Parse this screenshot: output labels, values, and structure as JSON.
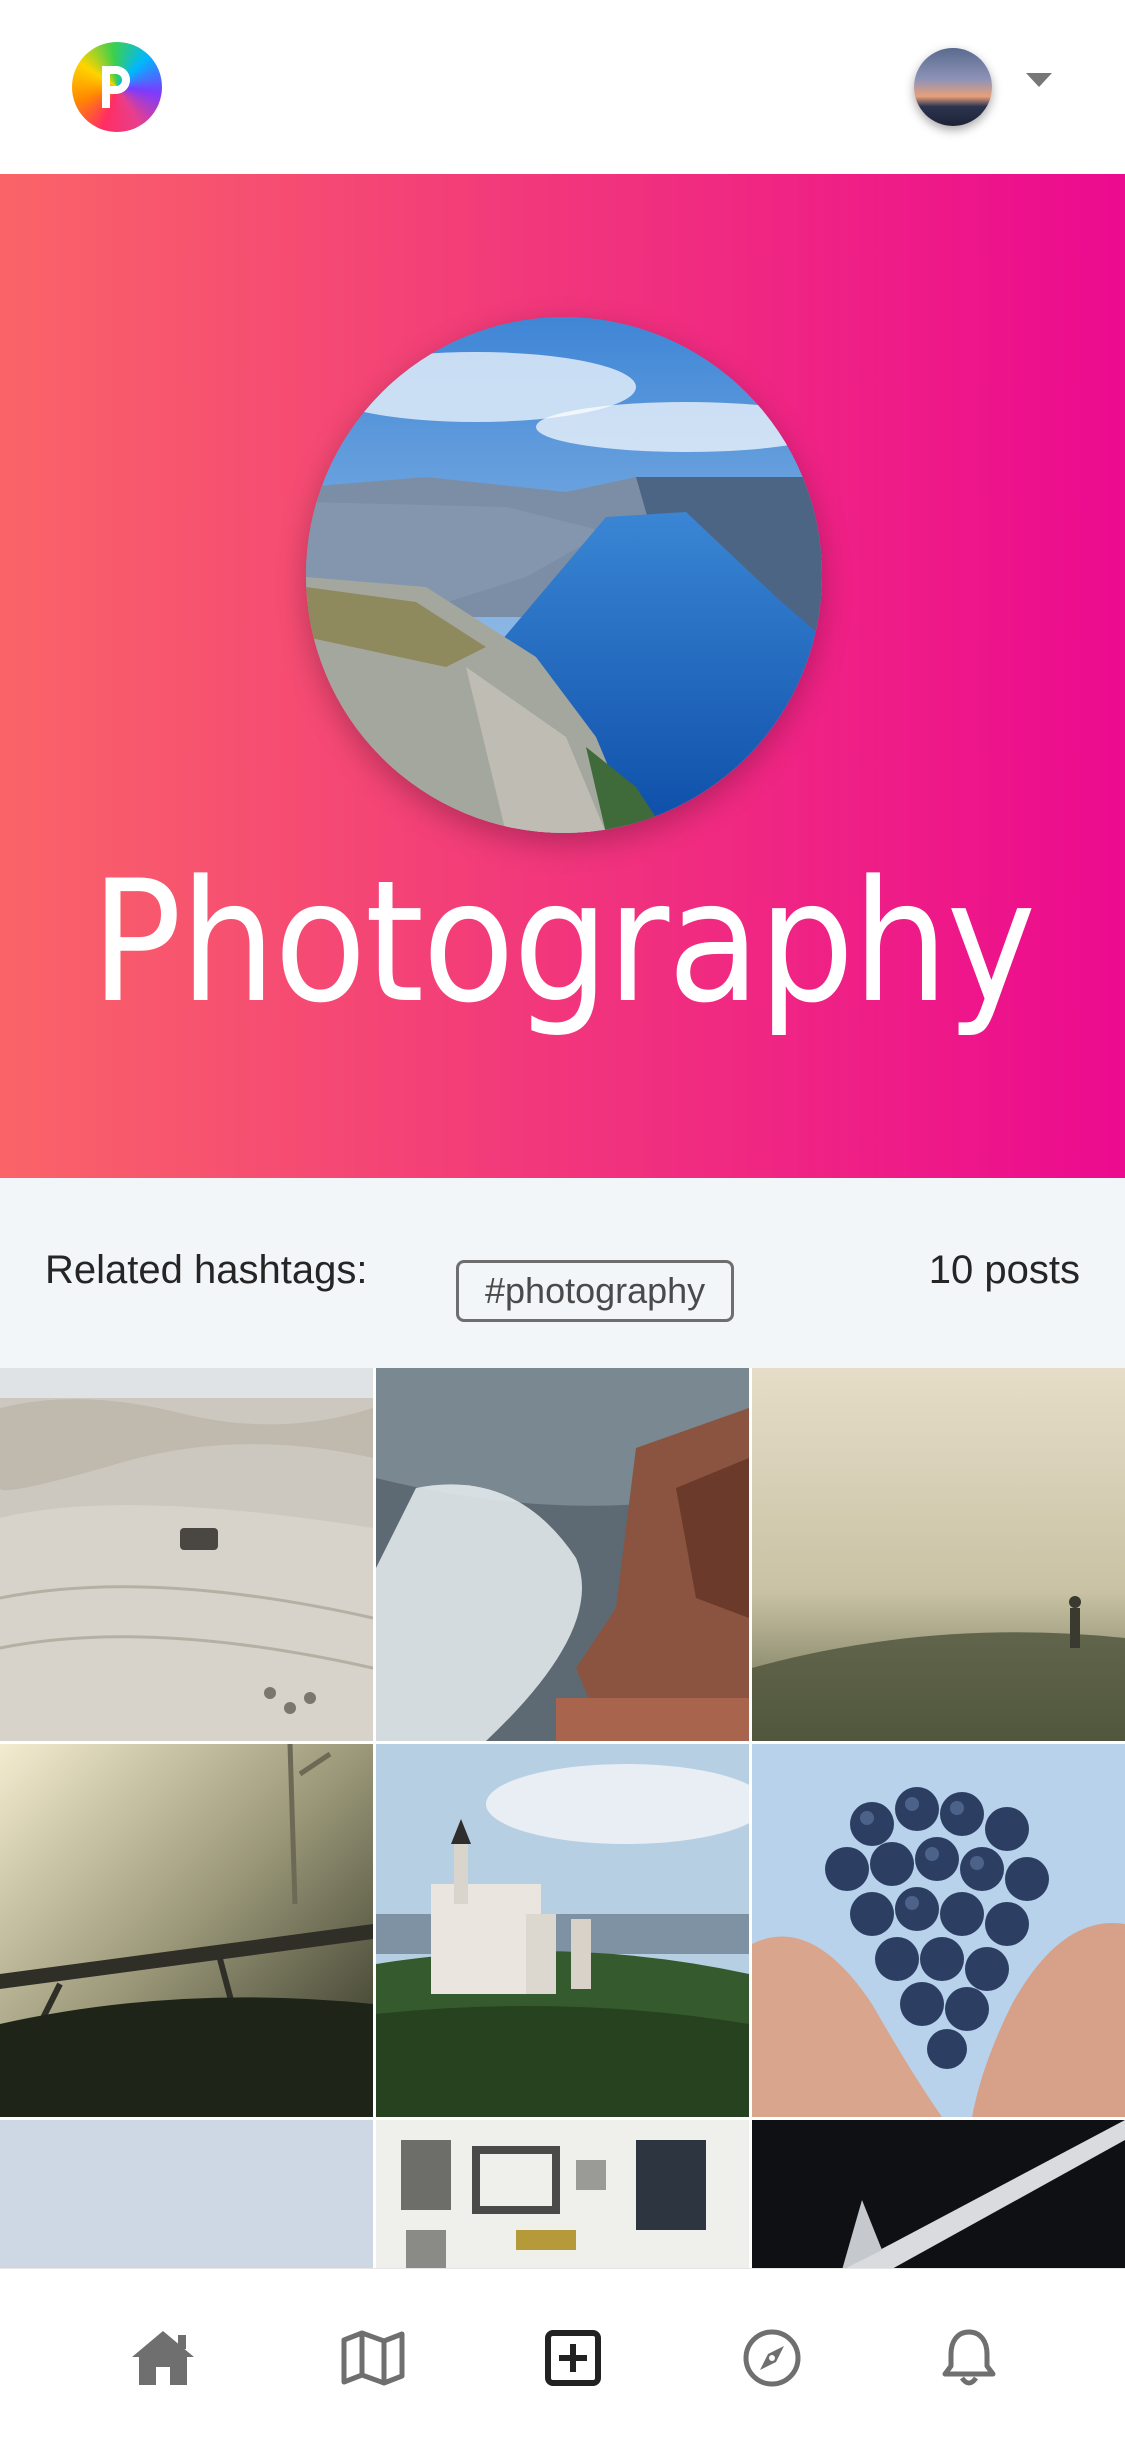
{
  "app": {
    "logo_icon": "app-logo-icon",
    "avatar_icon": "user-avatar",
    "menu_icon": "caret-down-icon"
  },
  "hero": {
    "title": "Photography",
    "cover_image": "fjord-cliff-photo",
    "gradient": [
      "#fa6468",
      "#ec0a8f"
    ]
  },
  "hashtags": {
    "label": "Related hashtags:",
    "tags": [
      "#photography"
    ],
    "post_count": "10 posts"
  },
  "grid": {
    "items": [
      "desert-dunes-jeep-photo",
      "ocean-wave-rocks-photo",
      "foggy-field-person-photo",
      "misty-forest-bridge-photo",
      "castle-forest-photo",
      "grapes-in-hands-photo",
      "pale-sky-photo",
      "parts-flatlay-photo",
      "dark-architecture-photo"
    ]
  },
  "bottom_nav": {
    "items": [
      "home-icon",
      "map-icon",
      "add-post-icon",
      "compass-icon",
      "bell-icon"
    ],
    "icon_color": "#6f6f6f",
    "active_color": "#222222"
  }
}
